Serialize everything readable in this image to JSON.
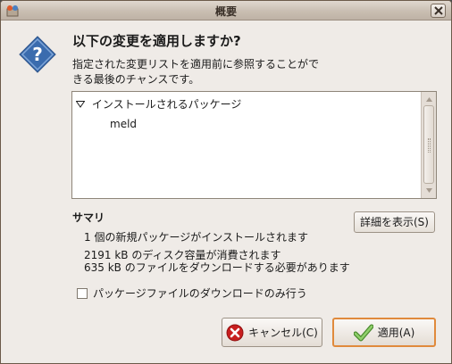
{
  "window": {
    "title": "概要"
  },
  "dialog": {
    "heading": "以下の変更を適用しますか?",
    "description_line1": "指定された変更リストを適用前に参照することがで",
    "description_line2": "きる最後のチャンスです。"
  },
  "changes_list": {
    "group_label": "インストールされるパッケージ",
    "items": [
      "meld"
    ]
  },
  "summary": {
    "title": "サマリ",
    "details_button": "詳細を表示(S)",
    "lines": [
      "1 個の新規パッケージがインストールされます",
      "2191 kB のディスク容量が消費されます",
      "635 kB のファイルをダウンロードする必要があります"
    ]
  },
  "download_only_checkbox": {
    "label": "パッケージファイルのダウンロードのみ行う",
    "checked": false
  },
  "buttons": {
    "cancel": "キャンセル(C)",
    "apply": "適用(A)"
  },
  "colors": {
    "window_bg": "#efebe7",
    "apply_focus": "#e08a3c",
    "question_icon": "#3b6cae",
    "cancel_icon": "#c81e1e",
    "apply_check": "#6ab04c"
  },
  "icons": {
    "question": "question-icon",
    "cancel": "cancel-icon",
    "apply": "check-icon",
    "close": "close-icon",
    "tree": "triangle-down-icon"
  }
}
